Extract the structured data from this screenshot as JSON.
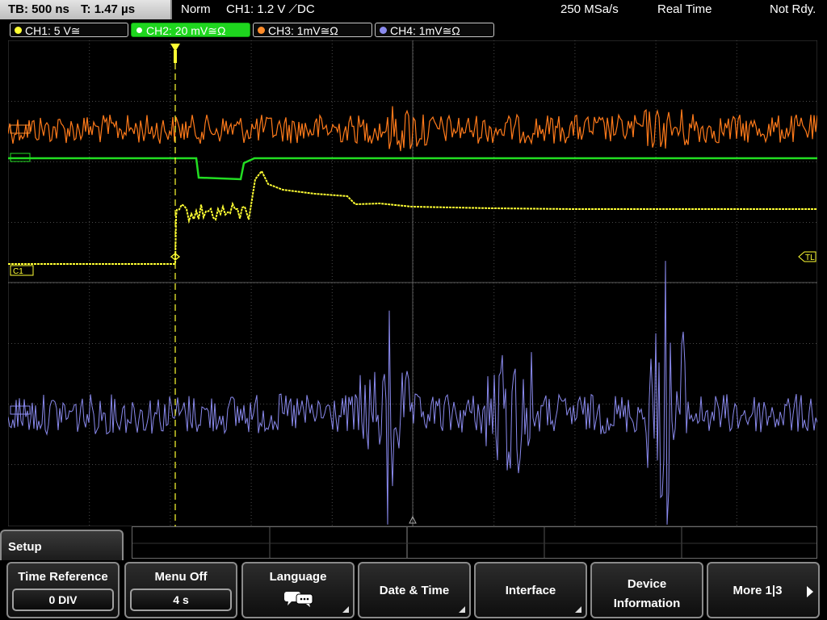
{
  "topbar": {
    "timebase": "TB: 500 ns",
    "trigger_time": "T: 1.47 µs",
    "mode": "Norm",
    "trigger_info": "CH1: 1.2 V ⟋DC",
    "sample_rate": "250 MSa/s",
    "acquisition": "Real Time",
    "status": "Not Rdy."
  },
  "channels": [
    {
      "label": "CH1: 5 V≅",
      "color": "#ffff33"
    },
    {
      "label": "CH2: 20 mV≅Ω",
      "color": "#22dd22"
    },
    {
      "label": "CH3: 1mV≅Ω",
      "color": "#ff8c2a"
    },
    {
      "label": "CH4: 1mV≅Ω",
      "color": "#8a8aee"
    }
  ],
  "markers": {
    "ch1": "C1",
    "trigger_level": "TL"
  },
  "setup_menu": {
    "title": "Setup",
    "softkeys": [
      {
        "label": "Time Reference",
        "value": "0 DIV"
      },
      {
        "label": "Menu Off",
        "value": "4 s"
      },
      {
        "label": "Language",
        "icon": "speech-bubbles-icon"
      },
      {
        "label": "Date & Time"
      },
      {
        "label": "Interface"
      },
      {
        "label_line1": "Device",
        "label_line2": "Information"
      },
      {
        "label": "More 1|3"
      }
    ]
  }
}
